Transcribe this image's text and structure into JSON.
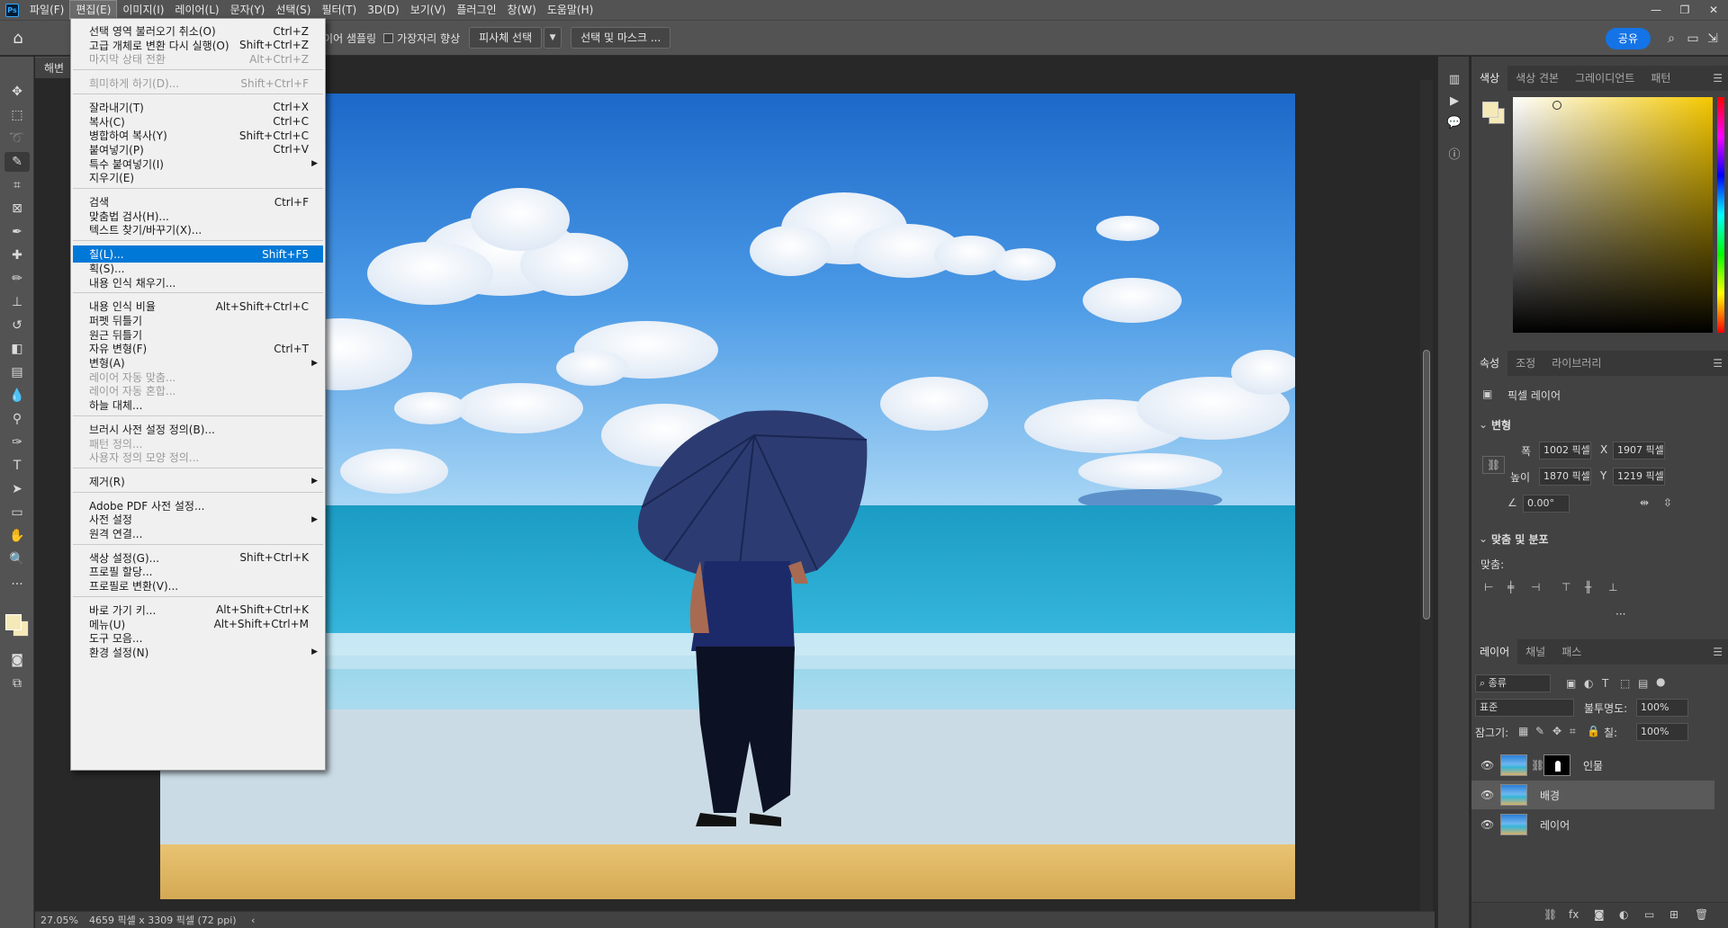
{
  "app": {
    "logo": "Ps"
  },
  "menubar": {
    "items": [
      "파일(F)",
      "편집(E)",
      "이미지(I)",
      "레이어(L)",
      "문자(Y)",
      "선택(S)",
      "필터(T)",
      "3D(D)",
      "보기(V)",
      "플러그인",
      "창(W)",
      "도움말(H)"
    ],
    "active_index": 1,
    "window_controls": [
      "—",
      "❐",
      "✕"
    ]
  },
  "options": {
    "sample_label": "레이어 샘플링",
    "edge_label": "가장자리 향상",
    "subject_btn": "피사체 선택",
    "mask_btn": "선택 및 마스크 ...",
    "share": "공유"
  },
  "document": {
    "tab_title": "해변",
    "tab2_suffix": ") *",
    "zoom": "27.05%",
    "size_info": "4659 픽셀 x 3309 픽셀 (72 ppi)"
  },
  "edit_menu": [
    {
      "label": "선택 영역 불러오기 취소(O)",
      "shortcut": "Ctrl+Z"
    },
    {
      "label": "고급 개체로 변환 다시 실행(O)",
      "shortcut": "Shift+Ctrl+Z"
    },
    {
      "label": "마지막 상태 전환",
      "shortcut": "Alt+Ctrl+Z",
      "disabled": true
    },
    {
      "sep": true
    },
    {
      "label": "희미하게 하기(D)...",
      "shortcut": "Shift+Ctrl+F",
      "disabled": true
    },
    {
      "sep": true
    },
    {
      "label": "잘라내기(T)",
      "shortcut": "Ctrl+X"
    },
    {
      "label": "복사(C)",
      "shortcut": "Ctrl+C"
    },
    {
      "label": "병합하여 복사(Y)",
      "shortcut": "Shift+Ctrl+C"
    },
    {
      "label": "붙여넣기(P)",
      "shortcut": "Ctrl+V"
    },
    {
      "label": "특수 붙여넣기(I)",
      "submenu": true
    },
    {
      "label": "지우기(E)"
    },
    {
      "sep": true
    },
    {
      "label": "검색",
      "shortcut": "Ctrl+F"
    },
    {
      "label": "맞춤법 검사(H)..."
    },
    {
      "label": "텍스트 찾기/바꾸기(X)..."
    },
    {
      "sep": true
    },
    {
      "label": "칠(L)...",
      "shortcut": "Shift+F5",
      "highlighted": true
    },
    {
      "label": "획(S)..."
    },
    {
      "label": "내용 인식 채우기..."
    },
    {
      "sep": true
    },
    {
      "label": "내용 인식 비율",
      "shortcut": "Alt+Shift+Ctrl+C"
    },
    {
      "label": "퍼펫 뒤틀기"
    },
    {
      "label": "원근 뒤틀기"
    },
    {
      "label": "자유 변형(F)",
      "shortcut": "Ctrl+T"
    },
    {
      "label": "변형(A)",
      "submenu": true
    },
    {
      "label": "레이어 자동 맞춤...",
      "disabled": true
    },
    {
      "label": "레이어 자동 혼합...",
      "disabled": true
    },
    {
      "label": "하늘 대체..."
    },
    {
      "sep": true
    },
    {
      "label": "브러시 사전 설정 정의(B)..."
    },
    {
      "label": "패턴 정의...",
      "disabled": true
    },
    {
      "label": "사용자 정의 모양 정의...",
      "disabled": true
    },
    {
      "sep": true
    },
    {
      "label": "제거(R)",
      "submenu": true
    },
    {
      "sep": true
    },
    {
      "label": "Adobe PDF 사전 설정..."
    },
    {
      "label": "사전 설정",
      "submenu": true
    },
    {
      "label": "원격 연결..."
    },
    {
      "sep": true
    },
    {
      "label": "색상 설정(G)...",
      "shortcut": "Shift+Ctrl+K"
    },
    {
      "label": "프로필 할당..."
    },
    {
      "label": "프로필로 변환(V)..."
    },
    {
      "sep": true
    },
    {
      "label": "바로 가기 키...",
      "shortcut": "Alt+Shift+Ctrl+K"
    },
    {
      "label": "메뉴(U)",
      "shortcut": "Alt+Shift+Ctrl+M"
    },
    {
      "label": "도구 모음..."
    },
    {
      "label": "환경 설정(N)",
      "submenu": true
    }
  ],
  "color_panel": {
    "tabs": [
      "색상",
      "색상 견본",
      "그레이디언트",
      "패턴"
    ],
    "fg_color": "#f5e9b8"
  },
  "properties_panel": {
    "tabs": [
      "속성",
      "조정",
      "라이브러리"
    ],
    "layer_type": "픽셀 레이어",
    "transform_title": "변형",
    "w_label": "폭",
    "w_value": "1002 픽셀",
    "x_label": "X",
    "x_value": "1907 픽셀",
    "h_label": "높이",
    "h_value": "1870 픽셀",
    "y_label": "Y",
    "y_value": "1219 픽셀",
    "angle": "0.00°",
    "align_title": "맞춤 및 분포",
    "align_label": "맞춤:",
    "more": "···"
  },
  "layers_panel": {
    "tabs": [
      "레이어",
      "채널",
      "패스"
    ],
    "filter": "종류",
    "blend_mode": "표준",
    "opacity_label": "불투명도:",
    "opacity": "100%",
    "lock_label": "잠그기:",
    "fill_label": "칠:",
    "fill": "100%",
    "layers": [
      {
        "name": "인물",
        "has_mask": true,
        "selected": false
      },
      {
        "name": "배경",
        "has_mask": false,
        "selected": true
      },
      {
        "name": "레이어",
        "has_mask": false,
        "selected": false
      }
    ]
  }
}
